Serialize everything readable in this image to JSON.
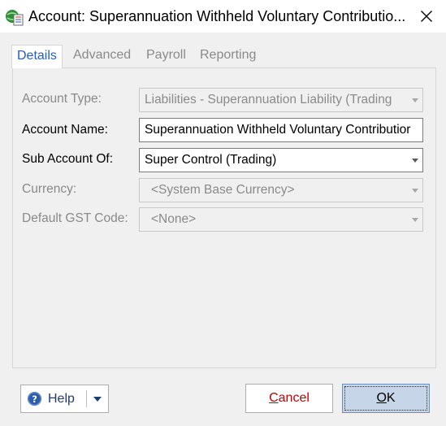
{
  "window": {
    "title": "Account: Superannuation Withheld Voluntary Contributio...",
    "app_icon": "globe-document-icon",
    "close_icon": "close-icon"
  },
  "tabs": [
    {
      "label": "Details",
      "active": true
    },
    {
      "label": "Advanced",
      "active": false
    },
    {
      "label": "Payroll",
      "active": false
    },
    {
      "label": "Reporting",
      "active": false
    }
  ],
  "fields": {
    "account_type": {
      "label": "Account Type:",
      "value": "Liabilities - Superannuation Liability (Trading",
      "enabled": false
    },
    "account_name": {
      "label": "Account Name:",
      "value": "Superannuation Withheld Voluntary Contributior",
      "enabled": true
    },
    "sub_account_of": {
      "label": "Sub Account Of:",
      "value": "Super Control (Trading)",
      "enabled": true
    },
    "currency": {
      "label": "Currency:",
      "value": "<System Base Currency>",
      "enabled": false
    },
    "default_gst_code": {
      "label": "Default GST Code:",
      "value": "<None>",
      "enabled": false
    }
  },
  "buttons": {
    "help": {
      "label": "Help",
      "icon": "help-icon"
    },
    "cancel": {
      "first": "C",
      "rest": "ancel"
    },
    "ok": {
      "first": "O",
      "rest": "K"
    }
  },
  "colors": {
    "active_tab": "#1f5fbf",
    "cancel_text": "#c00000",
    "ok_background": "#c6d5e8",
    "help_icon": "#2d5ca8"
  }
}
